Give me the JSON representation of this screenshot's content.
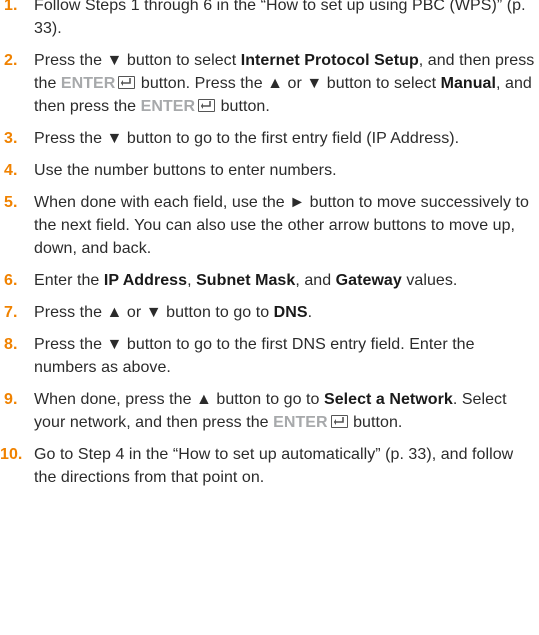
{
  "steps": [
    {
      "num": "1.",
      "parts": [
        {
          "t": "Follow Steps 1 through 6 in the “How to set up using PBC (WPS)” (p. 33)."
        }
      ]
    },
    {
      "num": "2.",
      "parts": [
        {
          "t": "Press the ▼ button to select "
        },
        {
          "t": "Internet Protocol Setup",
          "s": "b"
        },
        {
          "t": ", and then press the "
        },
        {
          "t": "ENTER",
          "s": "enter"
        },
        {
          "icon": "enter"
        },
        {
          "t": " button. Press the ▲ or ▼ button to select "
        },
        {
          "t": "Manual",
          "s": "b"
        },
        {
          "t": ", and then press the "
        },
        {
          "t": "ENTER",
          "s": "enter"
        },
        {
          "icon": "enter"
        },
        {
          "t": " button."
        }
      ]
    },
    {
      "num": "3.",
      "parts": [
        {
          "t": "Press the ▼ button to go to the first entry field (IP Address)."
        }
      ]
    },
    {
      "num": "4.",
      "parts": [
        {
          "t": "Use the number buttons to enter numbers."
        }
      ]
    },
    {
      "num": "5.",
      "parts": [
        {
          "t": "When done with each field, use the ► button to move successively to the next field. You can also use the other arrow buttons to move up, down, and back."
        }
      ]
    },
    {
      "num": "6.",
      "parts": [
        {
          "t": "Enter the "
        },
        {
          "t": "IP Address",
          "s": "b"
        },
        {
          "t": ", "
        },
        {
          "t": "Subnet Mask",
          "s": "b"
        },
        {
          "t": ", and "
        },
        {
          "t": "Gateway",
          "s": "b"
        },
        {
          "t": " values."
        }
      ]
    },
    {
      "num": "7.",
      "parts": [
        {
          "t": "Press the ▲ or ▼ button to go to "
        },
        {
          "t": "DNS",
          "s": "b"
        },
        {
          "t": "."
        }
      ]
    },
    {
      "num": "8.",
      "parts": [
        {
          "t": "Press the ▼ button to go to the first DNS entry field. Enter the numbers as above."
        }
      ]
    },
    {
      "num": "9.",
      "parts": [
        {
          "t": "When done, press the ▲ button to go to "
        },
        {
          "t": "Select a Network",
          "s": "b"
        },
        {
          "t": ". Select your network, and then press the "
        },
        {
          "t": "ENTER",
          "s": "enter"
        },
        {
          "icon": "enter"
        },
        {
          "t": " button."
        }
      ]
    },
    {
      "num": "10.",
      "parts": [
        {
          "t": "Go to Step 4 in the “How to set up automatically” (p. 33), and follow the directions from that point on."
        }
      ]
    }
  ],
  "colors": {
    "step_number": "#f08200",
    "enter_label": "#a7a9ab",
    "body_text": "#2b2b2b"
  },
  "icons": {
    "enter": "enter-key-icon"
  }
}
